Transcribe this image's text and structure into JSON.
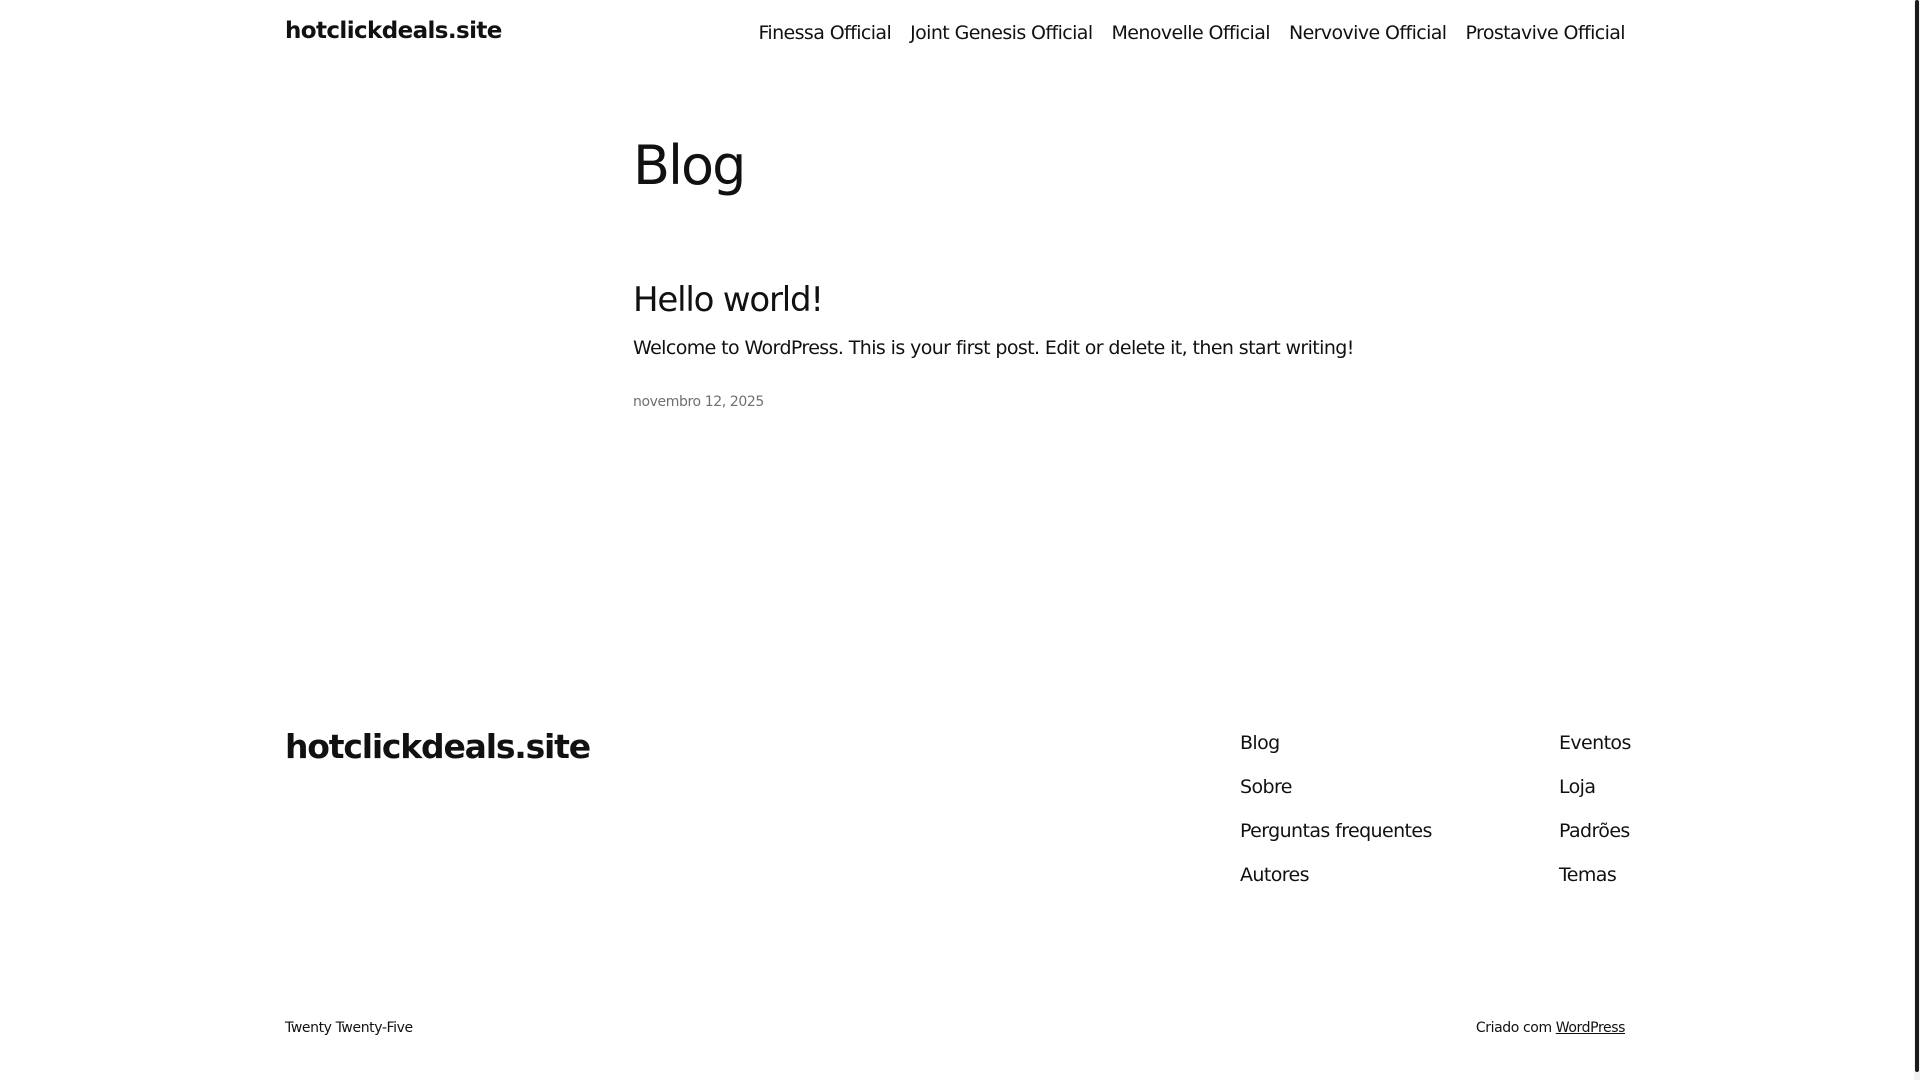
{
  "header": {
    "site_title": "hotclickdeals.site",
    "nav": [
      "Finessa Official",
      "Joint Genesis Official",
      "Menovelle Official",
      "Nervovive Official",
      "Prostavive Official"
    ]
  },
  "main": {
    "page_title": "Blog",
    "post": {
      "title": "Hello world!",
      "excerpt": "Welcome to WordPress. This is your first post. Edit or delete it, then start writing!",
      "date": "novembro 12, 2025"
    }
  },
  "footer": {
    "site_title": "hotclickdeals.site",
    "column_1": [
      "Blog",
      "Sobre",
      "Perguntas frequentes",
      "Autores"
    ],
    "column_2": [
      "Eventos",
      "Loja",
      "Padrões",
      "Temas"
    ],
    "theme_credit": "Twenty Twenty-Five",
    "powered_by_prefix": "Criado com",
    "powered_by_link": "WordPress"
  }
}
